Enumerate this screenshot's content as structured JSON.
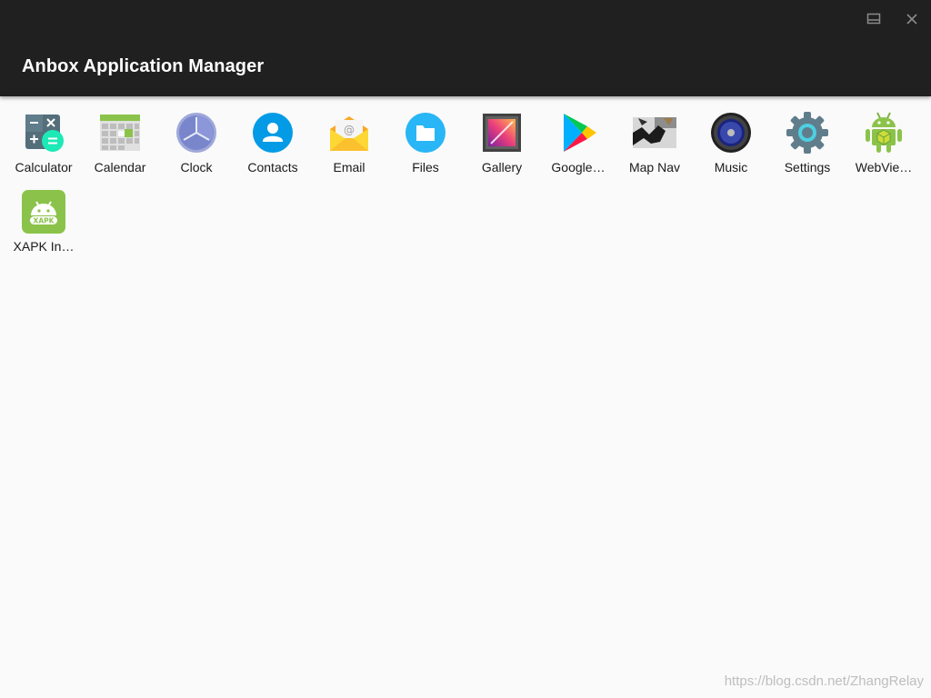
{
  "window": {
    "title": "Anbox Application Manager",
    "maximize_icon": "maximize-icon",
    "close_icon": "close-icon",
    "titlebar_color": "#202020",
    "background_color": "#fafafa"
  },
  "apps": [
    {
      "label": "Calculator",
      "icon": "calculator-icon"
    },
    {
      "label": "Calendar",
      "icon": "calendar-icon"
    },
    {
      "label": "Clock",
      "icon": "clock-icon"
    },
    {
      "label": "Contacts",
      "icon": "contacts-icon"
    },
    {
      "label": "Email",
      "icon": "email-icon"
    },
    {
      "label": "Files",
      "icon": "files-icon"
    },
    {
      "label": "Gallery",
      "icon": "gallery-icon"
    },
    {
      "label": "Google…",
      "icon": "google-play-icon"
    },
    {
      "label": "Map Nav",
      "icon": "map-nav-icon"
    },
    {
      "label": "Music",
      "icon": "music-icon"
    },
    {
      "label": "Settings",
      "icon": "settings-icon"
    },
    {
      "label": "WebVie…",
      "icon": "webview-android-icon"
    },
    {
      "label": "XAPK In…",
      "icon": "xapk-installer-icon",
      "badge": "XAPK"
    }
  ],
  "watermark": "https://blog.csdn.net/ZhangRelay"
}
